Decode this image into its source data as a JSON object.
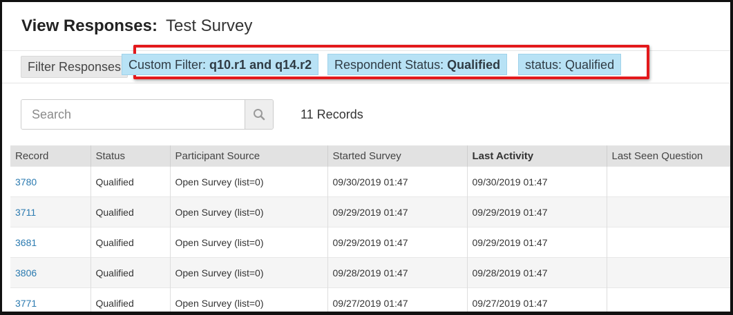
{
  "header": {
    "label": "View Responses:",
    "title": "Test Survey"
  },
  "filters": {
    "button_label": "Filter Responses",
    "chips": [
      {
        "prefix": "Custom Filter: ",
        "value": "q10.r1 and q14.r2"
      },
      {
        "prefix": "Respondent Status: ",
        "value": "Qualified"
      },
      {
        "prefix": "status: ",
        "value": "Qualified"
      }
    ],
    "highlight_color": "#e3191c",
    "chip_color": "#b8e2f5"
  },
  "search": {
    "placeholder": "Search",
    "value": "",
    "icon": "search-icon"
  },
  "records_count": "11 Records",
  "table": {
    "columns": [
      "Record",
      "Status",
      "Participant Source",
      "Started Survey",
      "Last Activity",
      "Last Seen Question"
    ],
    "rows": [
      [
        "3780",
        "Qualified",
        "Open Survey (list=0)",
        "09/30/2019 01:47",
        "09/30/2019 01:47",
        ""
      ],
      [
        "3711",
        "Qualified",
        "Open Survey (list=0)",
        "09/29/2019 01:47",
        "09/29/2019 01:47",
        ""
      ],
      [
        "3681",
        "Qualified",
        "Open Survey (list=0)",
        "09/29/2019 01:47",
        "09/29/2019 01:47",
        ""
      ],
      [
        "3806",
        "Qualified",
        "Open Survey (list=0)",
        "09/28/2019 01:47",
        "09/28/2019 01:47",
        ""
      ],
      [
        "3771",
        "Qualified",
        "Open Survey (list=0)",
        "09/27/2019 01:47",
        "09/27/2019 01:47",
        ""
      ]
    ],
    "link_color": "#2a7ab0"
  }
}
